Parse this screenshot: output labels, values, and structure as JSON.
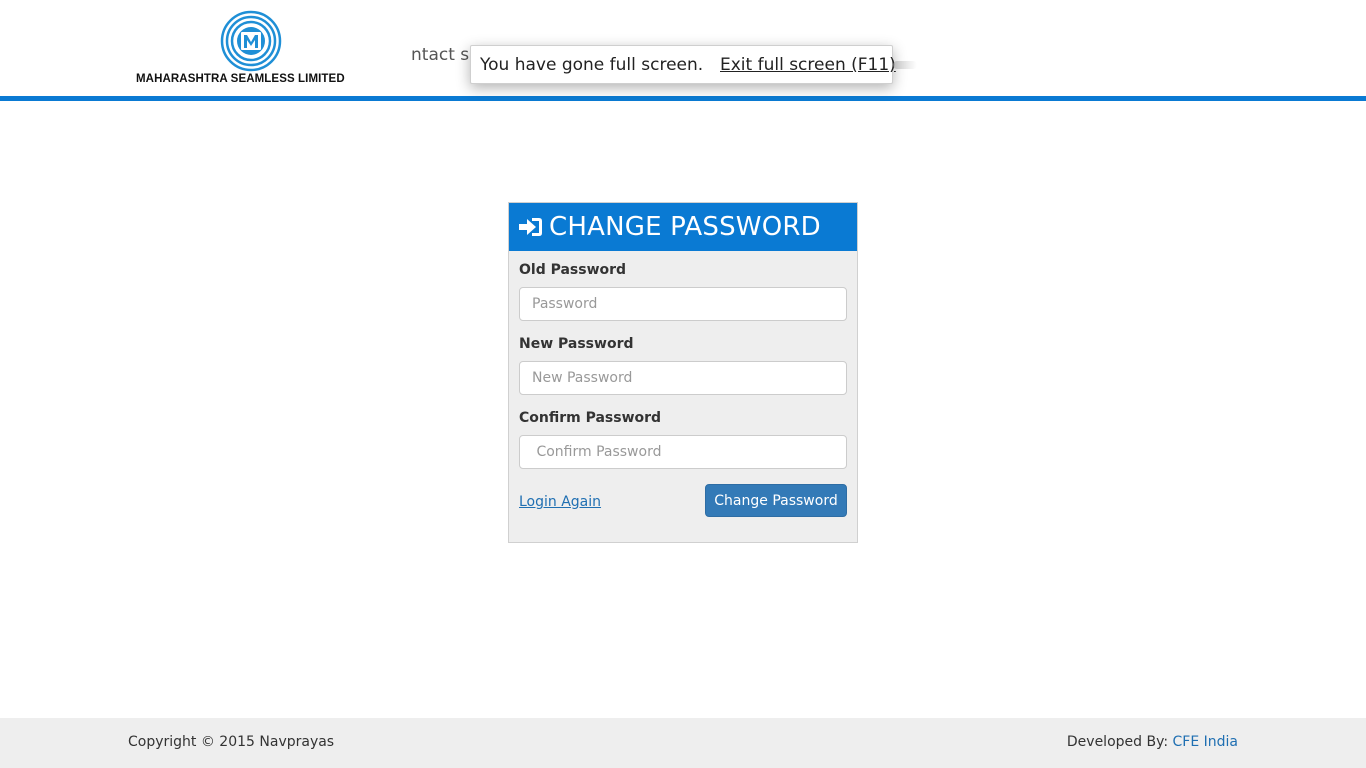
{
  "header": {
    "company_name": "MAHARASHTRA SEAMLESS LIMITED",
    "nav_fragment": "ntact su",
    "accent_color": "#0a7ad3"
  },
  "fullscreen_notice": {
    "message": "You have gone full screen.",
    "exit_label": "Exit full screen (F11)"
  },
  "form": {
    "icon": "sign-in-icon",
    "title": "CHANGE PASSWORD",
    "fields": [
      {
        "label": "Old Password",
        "placeholder": "Password",
        "value": ""
      },
      {
        "label": "New Password",
        "placeholder": "New Password",
        "value": ""
      },
      {
        "label": "Confirm Password",
        "placeholder": " Confirm Password",
        "value": ""
      }
    ],
    "login_again_label": "Login Again",
    "submit_label": "Change Password",
    "button_color": "#337ab7"
  },
  "footer": {
    "copyright": "Copyright © 2015 Navprayas",
    "developed_by_label": "Developed By:",
    "developer_link": "CFE India"
  }
}
